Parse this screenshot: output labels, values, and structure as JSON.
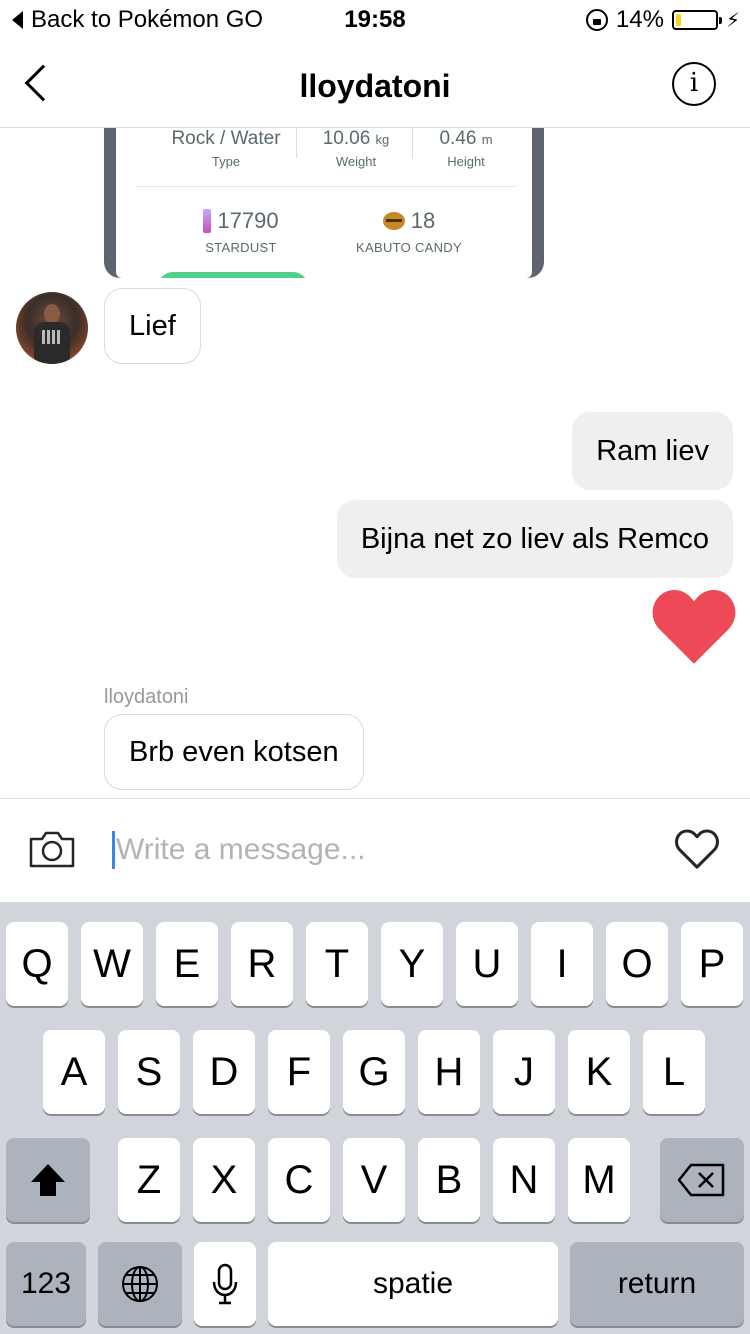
{
  "status_bar": {
    "back_label": "Back to Pokémon GO",
    "time": "19:58",
    "battery": "14%",
    "battery_level": 0.14
  },
  "nav": {
    "title": "lloydatoni"
  },
  "shared_image": {
    "stats": [
      {
        "value": "Rock / Water",
        "unit": "",
        "label": "Type"
      },
      {
        "value": "10.06",
        "unit": "kg",
        "label": "Weight"
      },
      {
        "value": "0.46",
        "unit": "m",
        "label": "Height"
      }
    ],
    "stardust": {
      "value": "17790",
      "label": "STARDUST"
    },
    "candy": {
      "value": "18",
      "label": "KABUTO CANDY"
    }
  },
  "messages": [
    {
      "text": "Lief",
      "direction": "in"
    },
    {
      "text": "Ram liev",
      "direction": "out"
    },
    {
      "text": "Bijna net zo liev als Remco",
      "direction": "out"
    },
    {
      "sender": "lloydatoni",
      "text": "Brb even kotsen",
      "direction": "in"
    }
  ],
  "compose": {
    "placeholder": "Write a message..."
  },
  "keyboard": {
    "row1": [
      "Q",
      "W",
      "E",
      "R",
      "T",
      "Y",
      "U",
      "I",
      "O",
      "P"
    ],
    "row2": [
      "A",
      "S",
      "D",
      "F",
      "G",
      "H",
      "J",
      "K",
      "L"
    ],
    "row3": [
      "Z",
      "X",
      "C",
      "V",
      "B",
      "N",
      "M"
    ],
    "numbers_label": "123",
    "space_label": "spatie",
    "return_label": "return"
  },
  "colors": {
    "heart": "#ed4956",
    "cursor": "#3b82f6",
    "battery": "#f5d21b"
  }
}
